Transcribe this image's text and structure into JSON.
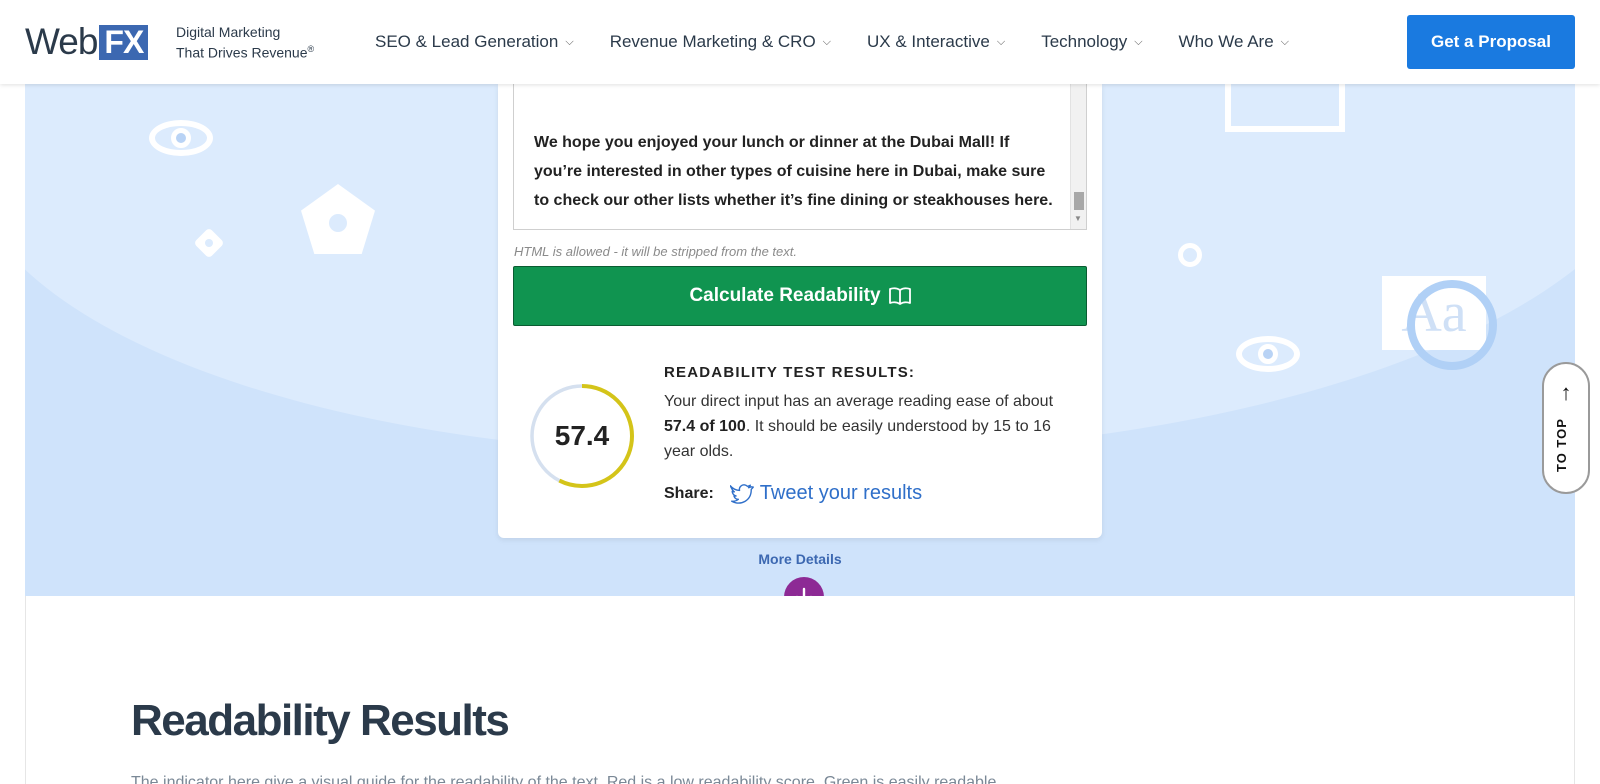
{
  "header": {
    "logo_web": "Web",
    "logo_fx": "FX",
    "tagline_line1": "Digital Marketing",
    "tagline_line2": "That Drives Revenue",
    "tagline_mark": "®",
    "nav": [
      {
        "label": "SEO & Lead Generation"
      },
      {
        "label": "Revenue Marketing & CRO"
      },
      {
        "label": "UX & Interactive"
      },
      {
        "label": "Technology"
      },
      {
        "label": "Who We Are"
      }
    ],
    "cta_label": "Get a Proposal"
  },
  "hero": {
    "aa_text": "Aa"
  },
  "tool": {
    "textarea_text": "We hope you enjoyed your lunch or dinner at the Dubai Mall! If you’re interested in other types of cuisine here in Dubai, make sure to check our other lists whether it’s fine dining or steakhouses here.",
    "html_note": "HTML is allowed - it will be stripped from the text.",
    "calc_label": "Calculate Readability",
    "score": "57.4",
    "score_fraction": 0.574,
    "results_title": "READABILITY TEST RESULTS:",
    "results_pre": "Your direct input has an average reading ease of about ",
    "results_bold": "57.4 of 100",
    "results_post": ". It should be easily understood by 15 to 16 year olds.",
    "share_label": "Share:",
    "tweet_label": "Tweet your results"
  },
  "more_details_label": "More Details",
  "section": {
    "heading": "Readability Results",
    "intro": "The indicator here give a visual guide for the readability of the text. Red is a low readability score. Green is easily readable."
  },
  "to_top_label": "TO TOP",
  "colors": {
    "brand_blue": "#3c68b1",
    "cta_blue": "#1a7ae0",
    "calc_green": "#109450",
    "gauge_yellow": "#d4c419",
    "more_purple": "#8d2a95"
  }
}
